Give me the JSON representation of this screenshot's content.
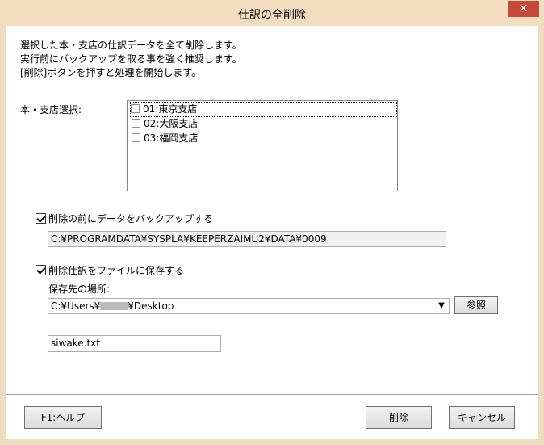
{
  "window": {
    "title": "仕訳の全削除",
    "close_symbol": "✕"
  },
  "description": [
    "選択した本・支店の仕訳データを全て削除します。",
    "実行前にバックアップを取る事を強く推奨します。",
    "[削除]ボタンを押すと処理を開始します。"
  ],
  "branch_select": {
    "label": "本・支店選択:",
    "items": [
      {
        "label": "01:東京支店",
        "checked": false
      },
      {
        "label": "02:大阪支店",
        "checked": false
      },
      {
        "label": "03:福岡支店",
        "checked": false
      }
    ]
  },
  "backup": {
    "label": "削除の前にデータをバックアップする",
    "checked": true,
    "path": "C:¥PROGRAMDATA¥SYSPLA¥KEEPERZAIMU2¥DATA¥0009"
  },
  "save_file": {
    "label": "削除仕訳をファイルに保存する",
    "checked": true,
    "location_label": "保存先の場所:",
    "location_prefix": "C:¥Users¥",
    "location_suffix": "¥Desktop",
    "browse_label": "参照",
    "filename": "siwake.txt"
  },
  "buttons": {
    "help": "F1:ヘルプ",
    "delete": "削除",
    "cancel": "キャンセル"
  }
}
